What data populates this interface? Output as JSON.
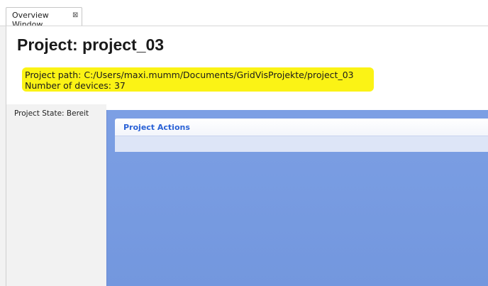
{
  "tab": {
    "label": "Overview Window",
    "close_glyph": "⊠",
    "close_icon": "close-tab-icon"
  },
  "project": {
    "title": "Project: project_03",
    "path_line": "Project path: C:/Users/maxi.mumm/Documents/GridVisProjekte/project_03",
    "devices_line": "Number of devices: 37",
    "highlight_color": "#fbf315"
  },
  "sidebar": {
    "state_label": "Project State: Bereit"
  },
  "actions_panel": {
    "title": "Project Actions",
    "title_color": "#2a62d6",
    "panel_color": "#7a9de2"
  }
}
